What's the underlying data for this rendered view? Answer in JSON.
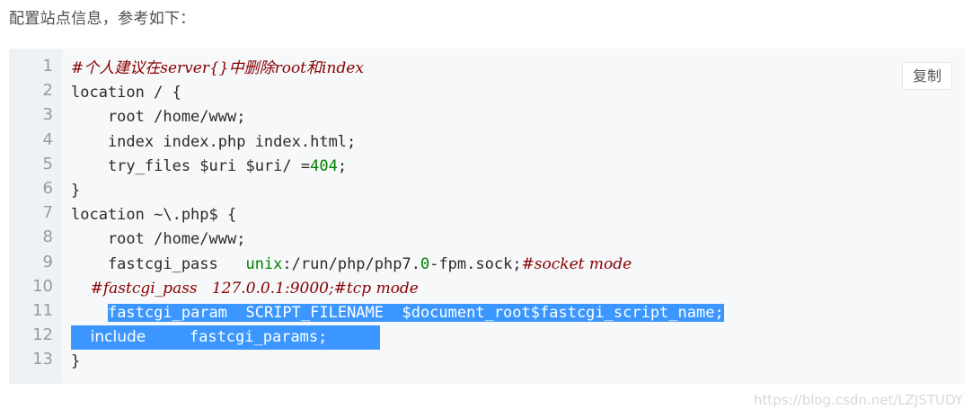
{
  "intro": "配置站点信息，参考如下：",
  "copy_label": "复制",
  "watermark": "https://blog.csdn.net/LZJSTUDY",
  "line_numbers": [
    "1",
    "2",
    "3",
    "4",
    "5",
    "6",
    "7",
    "8",
    "9",
    "10",
    "11",
    "12",
    "13"
  ],
  "code": {
    "l1": "#个人建议在server{}中删除root和index",
    "l2": "location / {",
    "l3": "    root /home/www;",
    "l4": "    index index.php index.html;",
    "l5a": "    try_files $uri $uri/ =",
    "l5b": "404",
    "l5c": ";",
    "l6": "}",
    "l7": "location ~\\.php$ {",
    "l8": "    root /home/www;",
    "l9a": "    fastcgi_pass   ",
    "l9b": "unix",
    "l9c": ":/run/php/php7.",
    "l9d": "0",
    "l9e": "-fpm.sock;",
    "l9f": "#socket mode",
    "l10": "    #fastcgi_pass   127.0.0.1:9000;#tcp mode",
    "l11a": "fastcgi_param",
    "l11b": "  SCRIPT_FILENAME  $document_root$fastcgi_script_name;",
    "l12a": "include",
    "l12b": "fastcgi_params;"
  }
}
